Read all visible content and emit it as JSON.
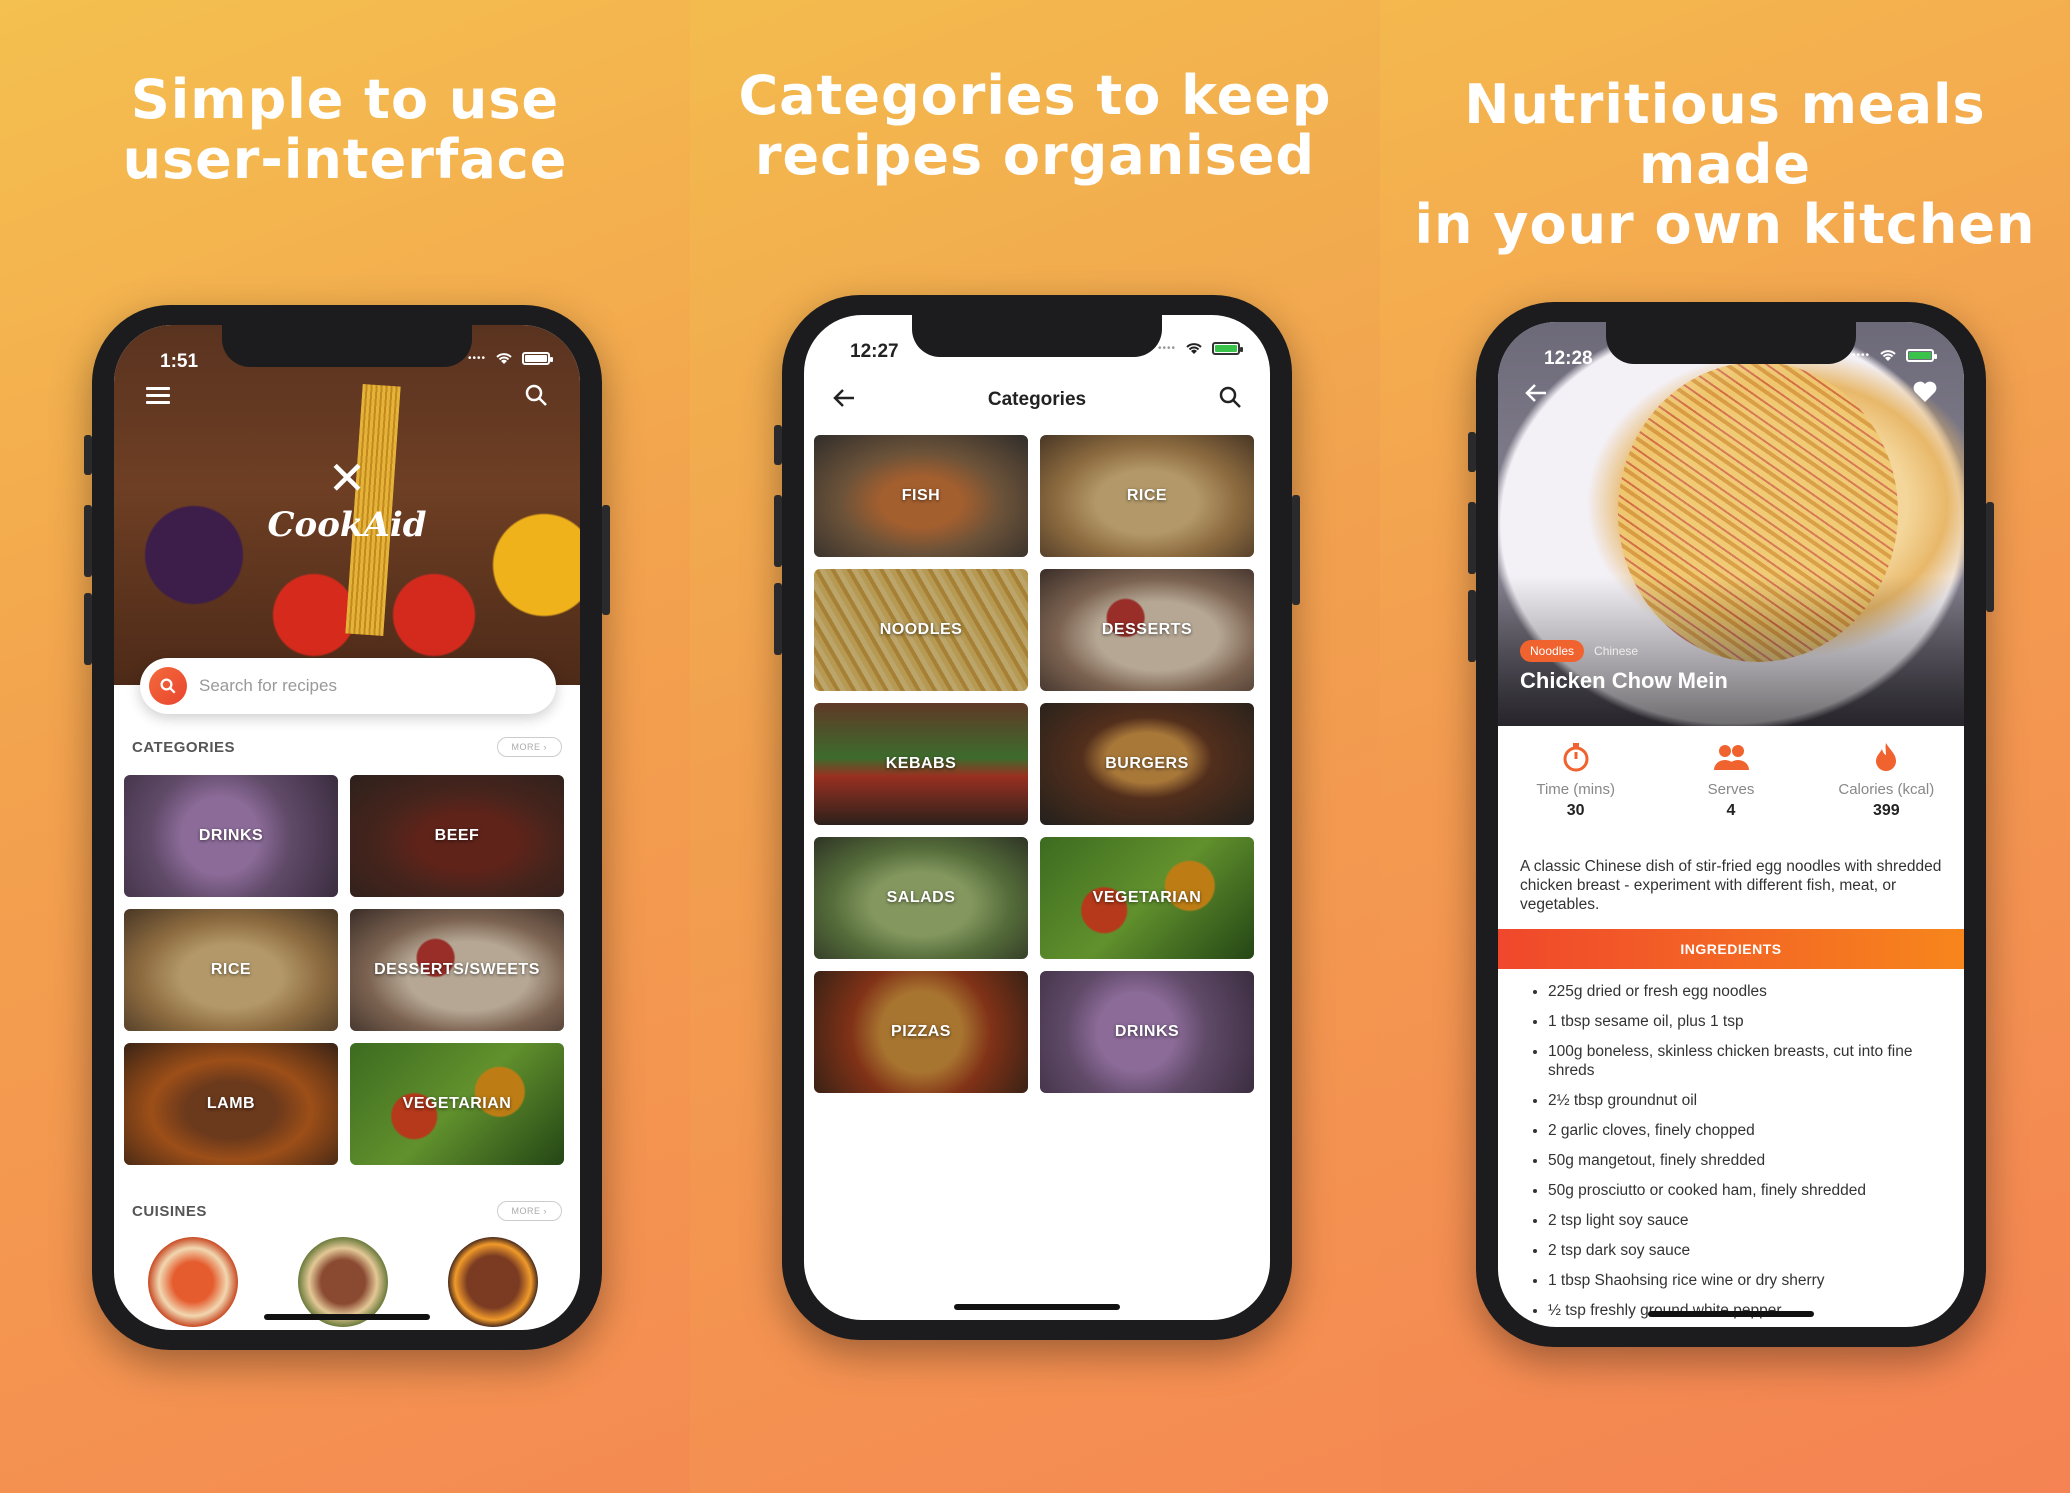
{
  "panels": [
    {
      "headline_line1": "Simple to use",
      "headline_line2": "user-interface"
    },
    {
      "headline_line1": "Categories to keep",
      "headline_line2": "recipes organised"
    },
    {
      "headline_line1": "Nutritious meals made",
      "headline_line2": "in your own kitchen"
    }
  ],
  "screen1": {
    "status_time": "1:51",
    "app_name": "CookAid",
    "search_placeholder": "Search for recipes",
    "categories_title": "CATEGORIES",
    "categories_more": "MORE ›",
    "categories": [
      "DRINKS",
      "BEEF",
      "RICE",
      "DESSERTS/SWEETS",
      "LAMB",
      "VEGETARIAN"
    ],
    "cuisines_title": "CUISINES",
    "cuisines_more": "MORE ›"
  },
  "screen2": {
    "status_time": "12:27",
    "title": "Categories",
    "categories": [
      "FISH",
      "RICE",
      "NOODLES",
      "DESSERTS",
      "KEBABS",
      "BURGERS",
      "SALADS",
      "VEGETARIAN",
      "PIZZAS",
      "DRINKS"
    ]
  },
  "screen3": {
    "status_time": "12:28",
    "tag_primary": "Noodles",
    "tag_secondary": "Chinese",
    "title": "Chicken Chow Mein",
    "stats": [
      {
        "label": "Time (mins)",
        "value": "30",
        "icon": "stopwatch-icon"
      },
      {
        "label": "Serves",
        "value": "4",
        "icon": "people-icon"
      },
      {
        "label": "Calories (kcal)",
        "value": "399",
        "icon": "flame-icon"
      }
    ],
    "description": "A classic Chinese dish of stir-fried egg noodles with shredded chicken breast - experiment with different fish, meat, or vegetables.",
    "ingredients_title": "INGREDIENTS",
    "ingredients": [
      "225g dried or fresh egg noodles",
      "1 tbsp sesame oil, plus 1 tsp",
      "100g boneless, skinless chicken breasts, cut into fine shreds",
      "2½ tbsp groundnut oil",
      "2 garlic cloves, finely chopped",
      "50g mangetout, finely shredded",
      "50g prosciutto or cooked ham, finely shredded",
      "2 tsp light soy sauce",
      "2 tsp dark soy sauce",
      "1 tbsp Shaohsing rice wine or dry sherry",
      "½ tsp freshly ground white pepper"
    ]
  },
  "colors": {
    "accent": "#f0632e",
    "ingredients_bar_start": "#f0472c",
    "ingredients_bar_end": "#f7861c"
  }
}
